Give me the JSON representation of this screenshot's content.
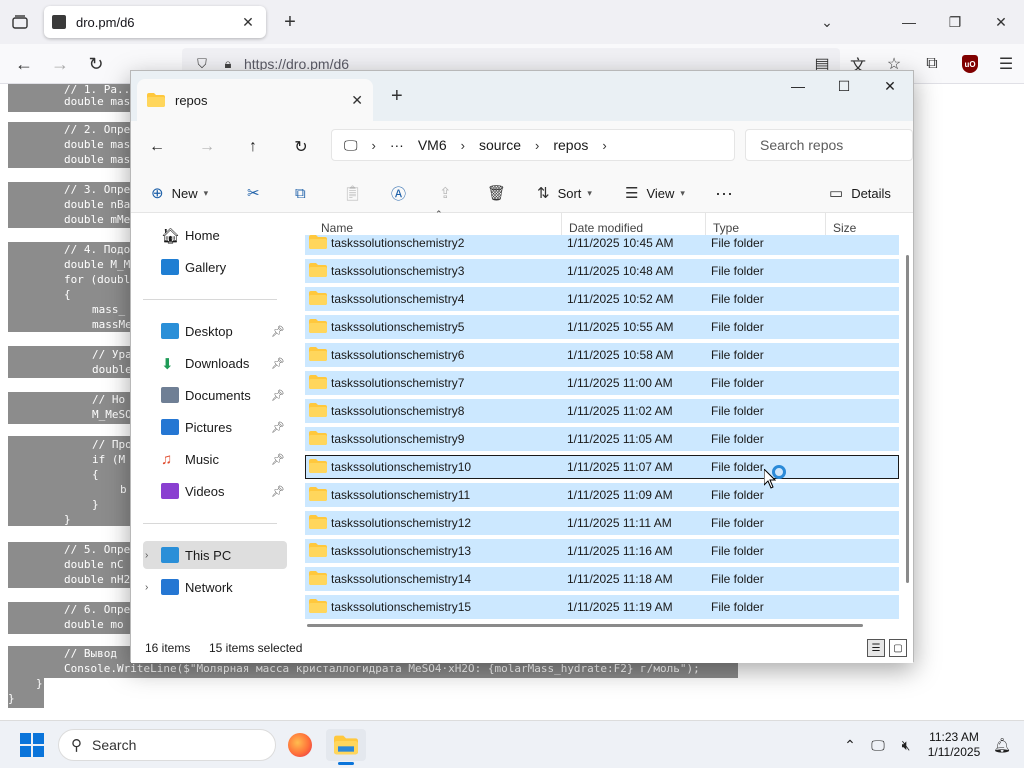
{
  "browser": {
    "tab_title": "dro.pm/d6",
    "url": "https://dro.pm/d6"
  },
  "code_lines": [
    "// 1. Ра...",
    "double mas",
    "// 2. Опре",
    "double mas",
    "double mas",
    "// 3. Опре",
    "double nBa",
    "double mMe",
    "// 4. Подо",
    "double M_M",
    "for (doubl",
    "{",
    "mass_",
    "massMe",
    "// Ура",
    "double",
    "// Ho",
    "M_MeSO",
    "// Про",
    "if (M",
    "{",
    "b",
    "}",
    "}",
    "// 5. Опре",
    "double nC",
    "double nH2",
    "// 6. Опре",
    "double mo",
    "// Вывод",
    "Console.WriteLine($\"Молярная масса кристаллогидрата MeSO4·xH2O: {molarMass_hydrate:F2} г/моль\");",
    "}",
    "}"
  ],
  "explorer": {
    "tab_title": "repos",
    "breadcrumb": [
      "VM6",
      "source",
      "repos"
    ],
    "search_placeholder": "Search repos",
    "commands": {
      "new": "New",
      "sort": "Sort",
      "view": "View",
      "details": "Details"
    },
    "nav": {
      "home": "Home",
      "gallery": "Gallery",
      "desktop": "Desktop",
      "downloads": "Downloads",
      "documents": "Documents",
      "pictures": "Pictures",
      "music": "Music",
      "videos": "Videos",
      "this_pc": "This PC",
      "network": "Network"
    },
    "columns": {
      "name": "Name",
      "date": "Date modified",
      "type": "Type",
      "size": "Size"
    },
    "files": [
      {
        "name": "taskssolutionschemistry2",
        "date": "1/11/2025 10:45 AM",
        "type": "File folder"
      },
      {
        "name": "taskssolutionschemistry3",
        "date": "1/11/2025 10:48 AM",
        "type": "File folder"
      },
      {
        "name": "taskssolutionschemistry4",
        "date": "1/11/2025 10:52 AM",
        "type": "File folder"
      },
      {
        "name": "taskssolutionschemistry5",
        "date": "1/11/2025 10:55 AM",
        "type": "File folder"
      },
      {
        "name": "taskssolutionschemistry6",
        "date": "1/11/2025 10:58 AM",
        "type": "File folder"
      },
      {
        "name": "taskssolutionschemistry7",
        "date": "1/11/2025 11:00 AM",
        "type": "File folder"
      },
      {
        "name": "taskssolutionschemistry8",
        "date": "1/11/2025 11:02 AM",
        "type": "File folder"
      },
      {
        "name": "taskssolutionschemistry9",
        "date": "1/11/2025 11:05 AM",
        "type": "File folder"
      },
      {
        "name": "taskssolutionschemistry10",
        "date": "1/11/2025 11:07 AM",
        "type": "File folder"
      },
      {
        "name": "taskssolutionschemistry11",
        "date": "1/11/2025 11:09 AM",
        "type": "File folder"
      },
      {
        "name": "taskssolutionschemistry12",
        "date": "1/11/2025 11:11 AM",
        "type": "File folder"
      },
      {
        "name": "taskssolutionschemistry13",
        "date": "1/11/2025 11:16 AM",
        "type": "File folder"
      },
      {
        "name": "taskssolutionschemistry14",
        "date": "1/11/2025 11:18 AM",
        "type": "File folder"
      },
      {
        "name": "taskssolutionschemistry15",
        "date": "1/11/2025 11:19 AM",
        "type": "File folder"
      }
    ],
    "status": {
      "items": "16 items",
      "selected": "15 items selected"
    }
  },
  "taskbar": {
    "search": "Search",
    "time": "11:23 AM",
    "date": "1/11/2025"
  },
  "colors": {
    "selection": "#cce8ff",
    "accent": "#0a74da",
    "code_highlight": "#8c8c8c"
  }
}
